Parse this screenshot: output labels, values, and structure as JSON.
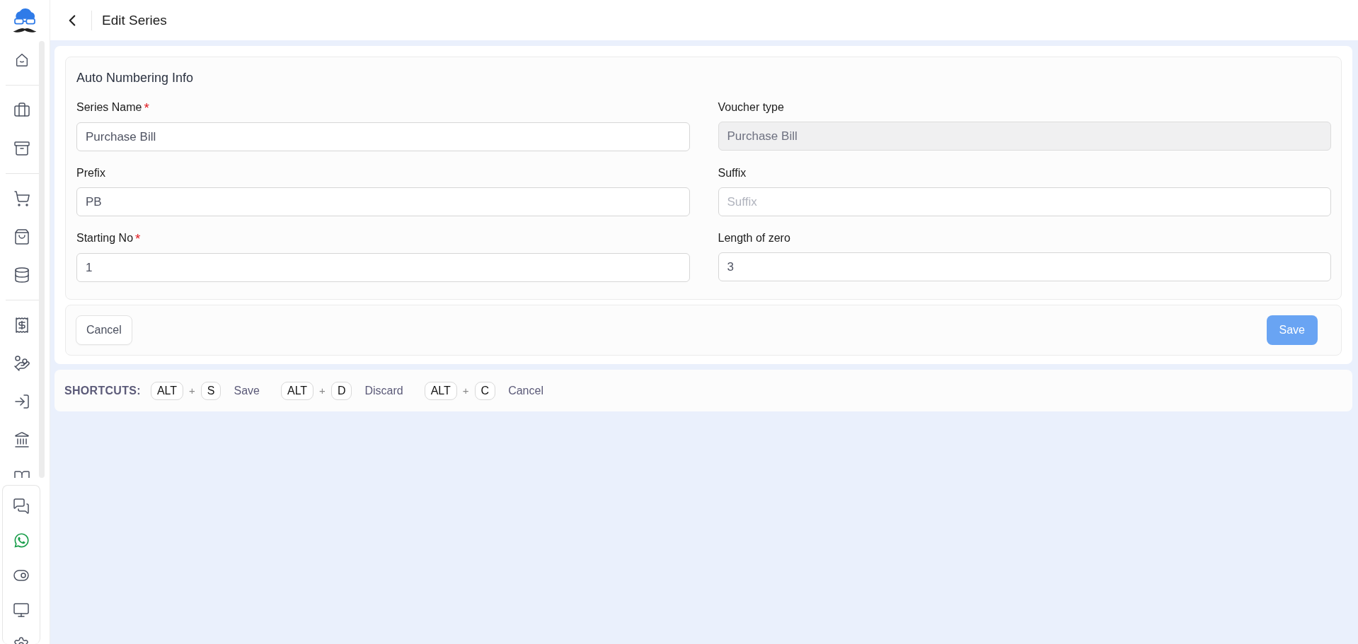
{
  "header": {
    "title": "Edit Series"
  },
  "form": {
    "title": "Auto Numbering Info",
    "fields": [
      {
        "label": "Series Name",
        "required": true,
        "disabled": false,
        "value": "Purchase Bill"
      },
      {
        "label": "Voucher type",
        "required": false,
        "disabled": true,
        "value": "Purchase Bill"
      },
      {
        "label": "Prefix",
        "required": false,
        "disabled": false,
        "value": "PB"
      },
      {
        "label": "Suffix",
        "required": false,
        "disabled": false,
        "placeholder": "Suffix"
      },
      {
        "label": "Starting No",
        "required": true,
        "disabled": false,
        "value": "1"
      },
      {
        "label": "Length of zero",
        "required": false,
        "disabled": false,
        "value": "3"
      }
    ],
    "required_mark": "*",
    "cancel": "Cancel",
    "save": {
      "label": "Save",
      "disabled": true
    }
  },
  "shortcuts": {
    "title": "SHORTCUTS:",
    "plus": "+",
    "items": [
      {
        "modifier": "ALT",
        "key": "S",
        "action": "Save"
      },
      {
        "modifier": "ALT",
        "key": "D",
        "action": "Discard"
      },
      {
        "modifier": "ALT",
        "key": "C",
        "action": "Cancel"
      }
    ]
  }
}
